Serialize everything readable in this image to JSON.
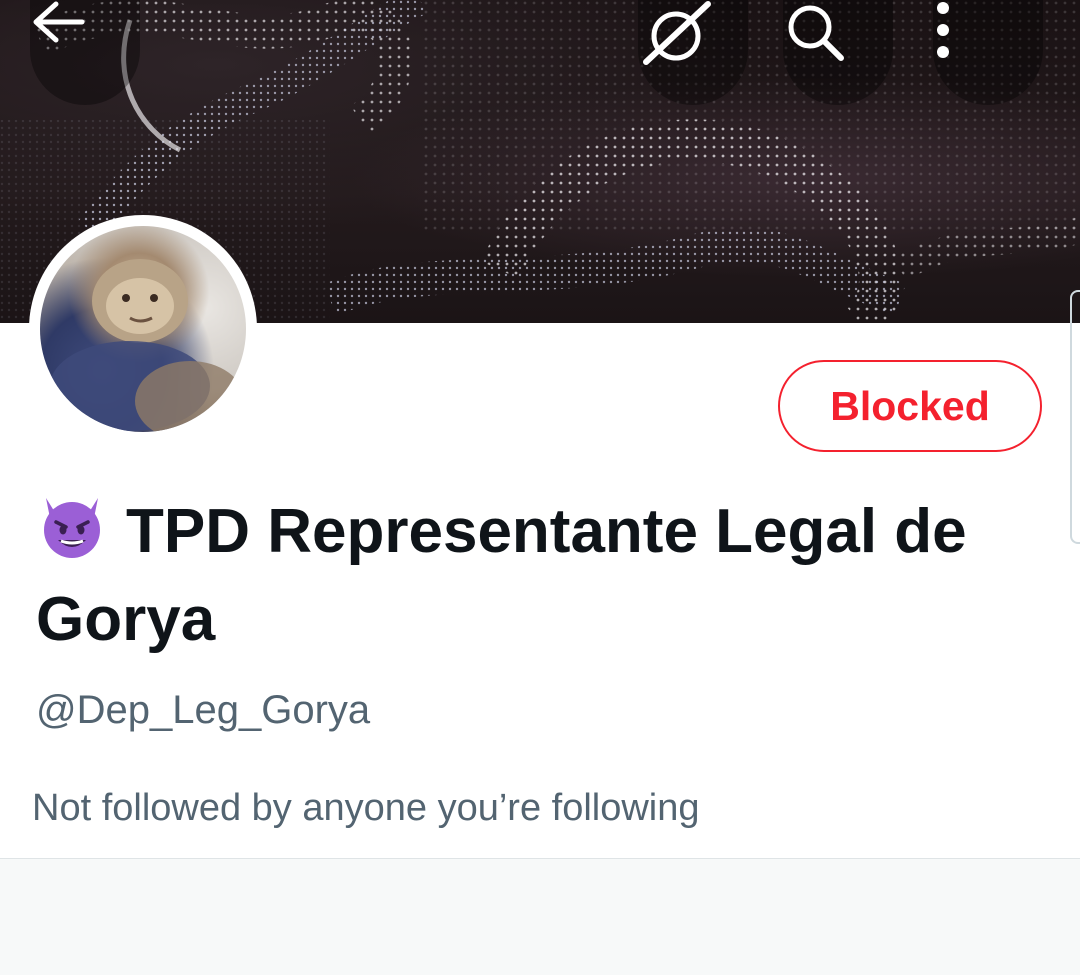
{
  "header": {
    "back_icon": "arrow-left-icon",
    "grok_icon": "grok-slash-icon",
    "search_icon": "search-icon",
    "more_icon": "more-vertical-icon"
  },
  "profile": {
    "display_name": "TPD Representante Legal de Gorya",
    "emoji": "smiling-face-with-horns-icon",
    "handle": "@Dep_Leg_Gorya",
    "followed_by_text": "Not followed by anyone you’re following",
    "blocked_label": "Blocked"
  },
  "colors": {
    "blocked_red": "#f4212e",
    "text_primary": "#0f1419",
    "text_secondary": "#536471",
    "emoji_purple": "#9b5fd6"
  }
}
